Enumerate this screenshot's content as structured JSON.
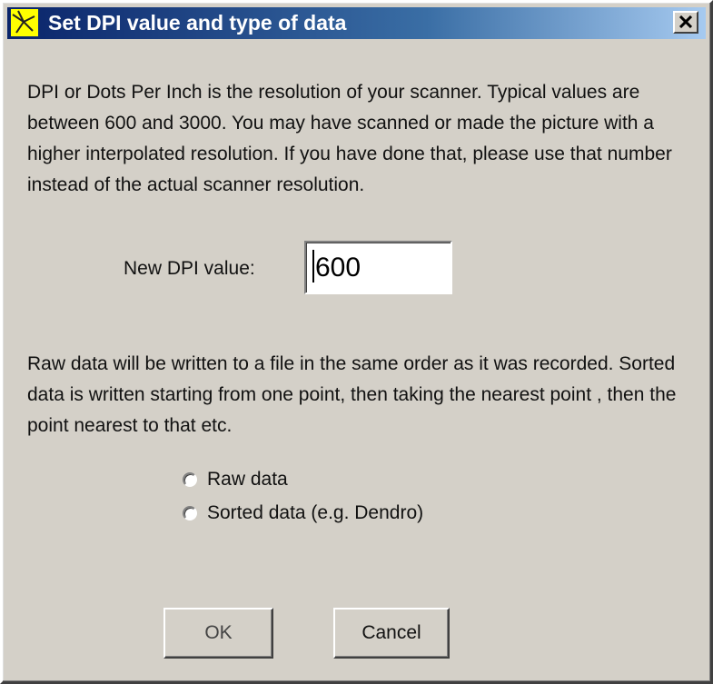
{
  "dialog": {
    "title": "Set DPI value and type of data",
    "title_icon": "app-logo-icon",
    "close_icon": "close-icon"
  },
  "intro_text": "DPI or Dots Per Inch is the resolution of your scanner. Typical values are between 600 and 3000. You may have scanned or made the picture with a higher interpolated resolution. If you have done that, please use that number instead of the actual scanner resolution.",
  "dpi": {
    "label": "New DPI value:",
    "value": "600"
  },
  "explanation_text": "Raw data will be written to a file in the same order as it was recorded. Sorted data is written starting from one point, then taking the nearest point , then the point nearest to that etc.",
  "data_type": {
    "options": [
      {
        "label": "Raw data",
        "selected": false
      },
      {
        "label": "Sorted data (e.g. Dendro)",
        "selected": false
      }
    ]
  },
  "buttons": {
    "ok_label": "OK",
    "cancel_label": "Cancel"
  },
  "colors": {
    "titlebar_start": "#0a246a",
    "titlebar_end": "#a6caf0",
    "face": "#d4d0c8",
    "icon_yellow": "#ffff00"
  }
}
